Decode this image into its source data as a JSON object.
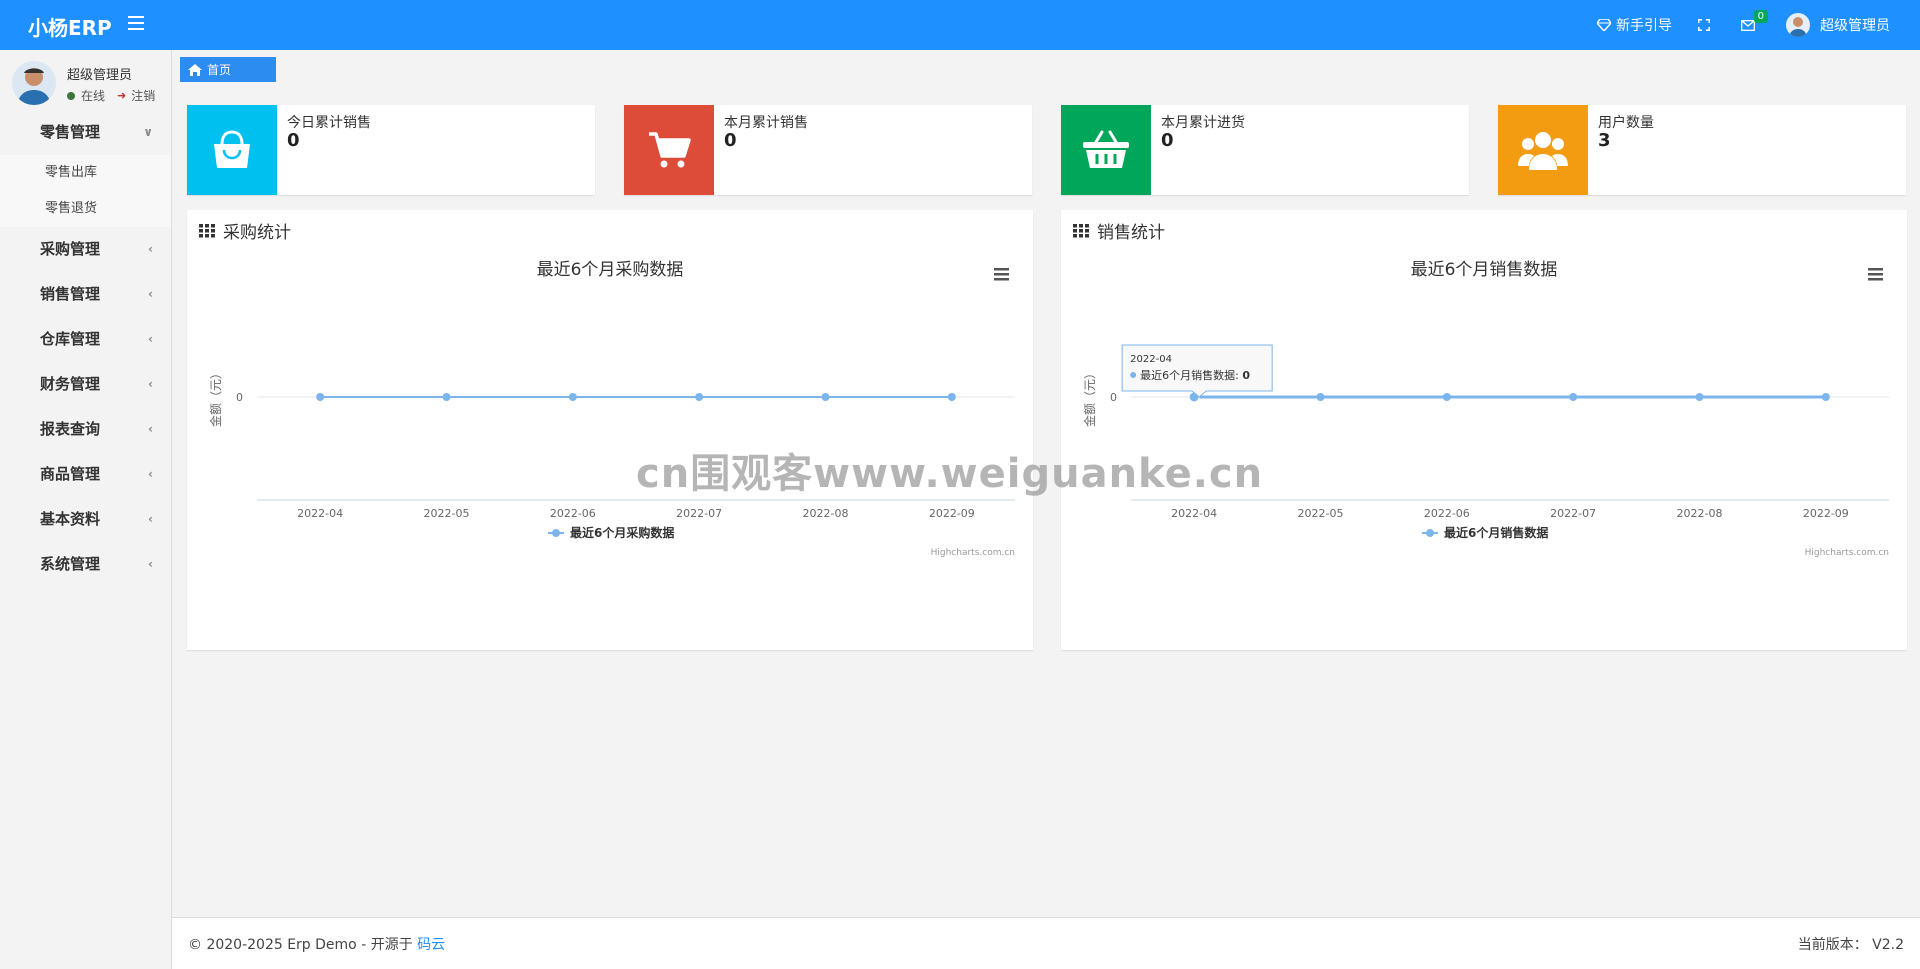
{
  "header": {
    "brand": "小杨ERP",
    "guide": "新手引导",
    "mail_count": "0",
    "user": "超级管理员",
    "color": "#1e90ff"
  },
  "sidebar": {
    "user_name": "超级管理员",
    "status": "在线",
    "logout": "注销",
    "menu": [
      {
        "label": "零售管理",
        "expanded": true,
        "children": [
          "零售出库",
          "零售退货"
        ]
      },
      {
        "label": "采购管理"
      },
      {
        "label": "销售管理"
      },
      {
        "label": "仓库管理"
      },
      {
        "label": "财务管理"
      },
      {
        "label": "报表查询"
      },
      {
        "label": "商品管理"
      },
      {
        "label": "基本资料"
      },
      {
        "label": "系统管理"
      }
    ]
  },
  "breadcrumb": {
    "home": "首页"
  },
  "info_boxes": [
    {
      "label": "今日累计销售",
      "value": "0",
      "color": "#00c0ef",
      "icon": "shopping-bag-icon"
    },
    {
      "label": "本月累计销售",
      "value": "0",
      "color": "#dd4b39",
      "icon": "shopping-cart-icon"
    },
    {
      "label": "本月累计进货",
      "value": "0",
      "color": "#00a65a",
      "icon": "basket-icon"
    },
    {
      "label": "用户数量",
      "value": "3",
      "color": "#f39c12",
      "icon": "users-icon"
    }
  ],
  "panels": {
    "purchase": {
      "title": "采购统计"
    },
    "sales": {
      "title": "销售统计",
      "tooltip_date": "2022-04",
      "tooltip_label": "最近6个月销售数据: ",
      "tooltip_value": "0"
    }
  },
  "chart_data": [
    {
      "type": "line",
      "title": "最近6个月采购数据",
      "x": [
        "2022-04",
        "2022-05",
        "2022-06",
        "2022-07",
        "2022-08",
        "2022-09"
      ],
      "series": [
        {
          "name": "最近6个月采购数据",
          "values": [
            0,
            0,
            0,
            0,
            0,
            0
          ]
        }
      ],
      "ylabel": "金额（元）",
      "yticks": [
        "0"
      ],
      "credits": "Highcharts.com.cn",
      "color": "#7cb5ec"
    },
    {
      "type": "line",
      "title": "最近6个月销售数据",
      "x": [
        "2022-04",
        "2022-05",
        "2022-06",
        "2022-07",
        "2022-08",
        "2022-09"
      ],
      "series": [
        {
          "name": "最近6个月销售数据",
          "values": [
            0,
            0,
            0,
            0,
            0,
            0
          ]
        }
      ],
      "ylabel": "金额（元）",
      "yticks": [
        "0"
      ],
      "credits": "Highcharts.com.cn",
      "color": "#7cb5ec"
    }
  ],
  "footer": {
    "copyright": "© 2020-2025 Erp Demo - 开源于 ",
    "link": "码云",
    "version_label": "当前版本：",
    "version": "V2.2"
  },
  "watermark": "cn围观客www.weiguanke.cn"
}
